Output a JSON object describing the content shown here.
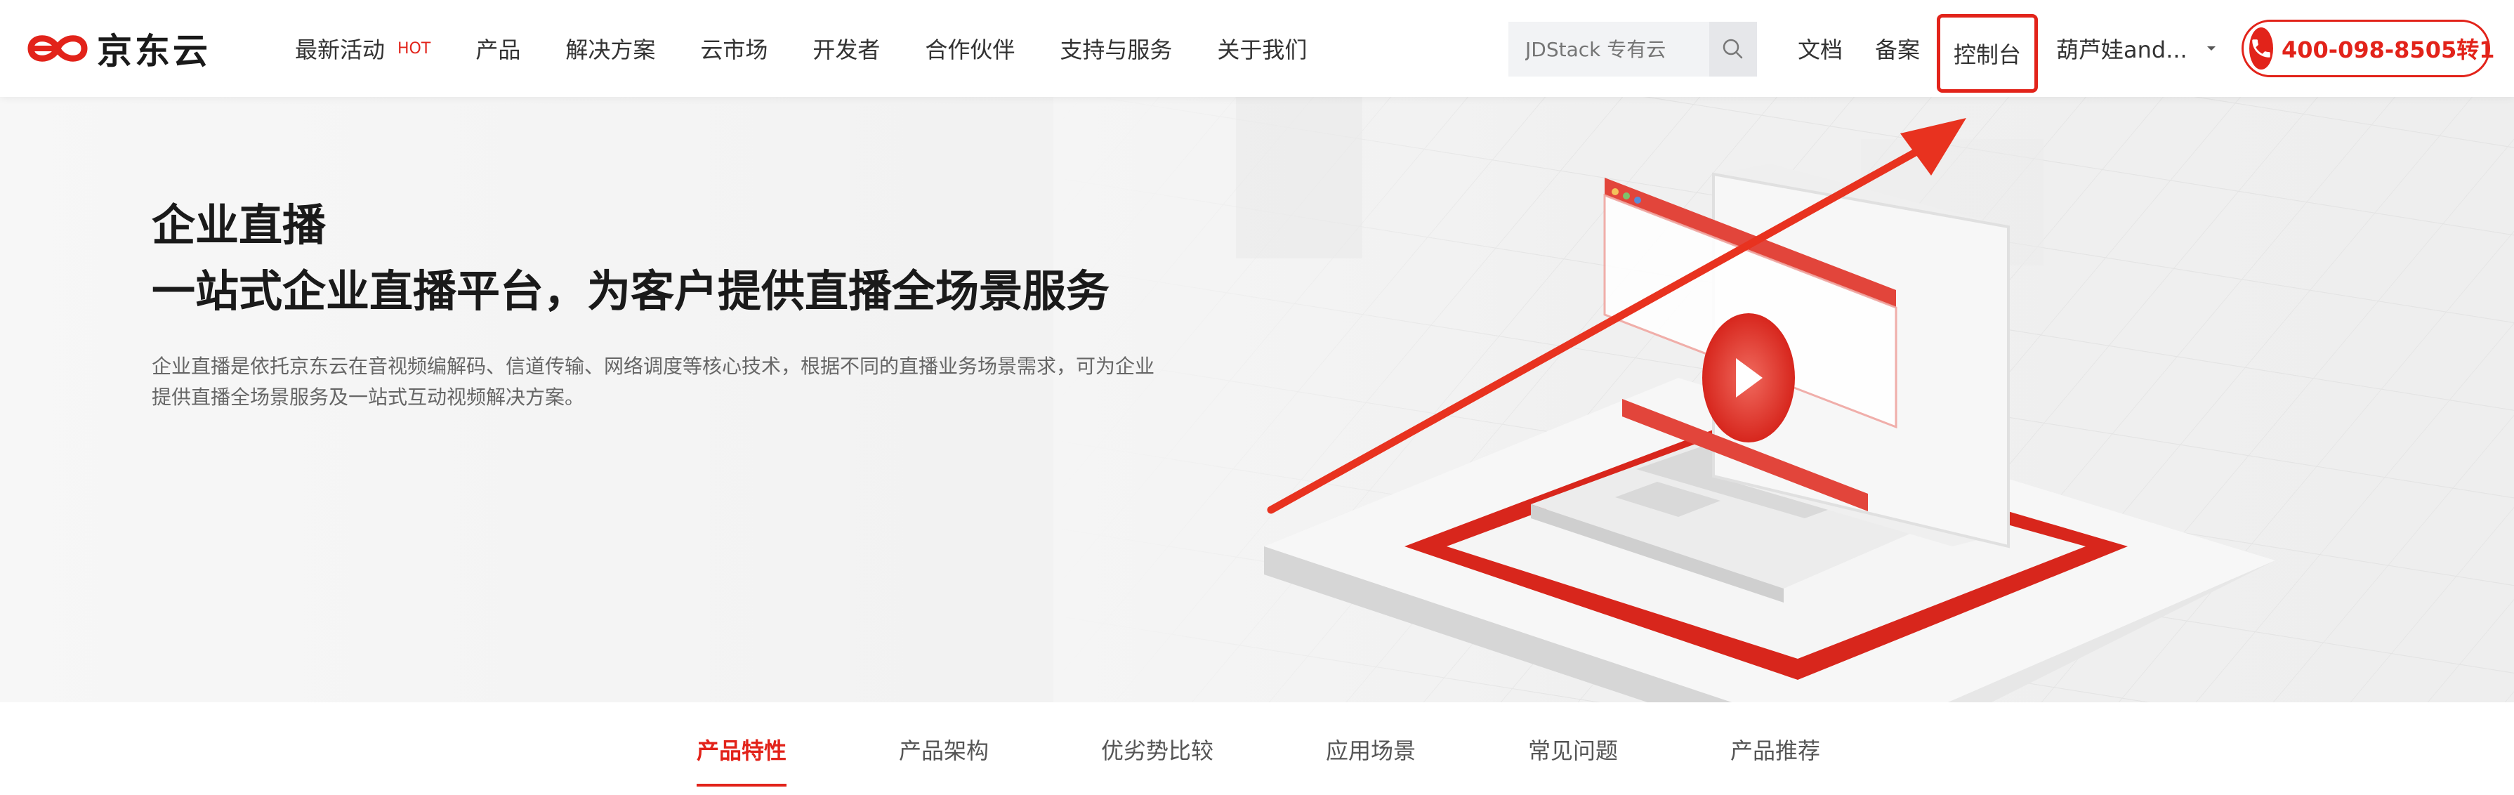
{
  "header": {
    "logo_text": "京东云",
    "nav": [
      {
        "label": "最新活动",
        "badge": "HOT"
      },
      {
        "label": "产品"
      },
      {
        "label": "解决方案"
      },
      {
        "label": "云市场"
      },
      {
        "label": "开发者"
      },
      {
        "label": "合作伙伴"
      },
      {
        "label": "支持与服务"
      },
      {
        "label": "关于我们"
      }
    ],
    "search": {
      "placeholder": "JDStack 专有云"
    },
    "docs_label": "文档",
    "beian_label": "备案",
    "console_label": "控制台",
    "user_name": "葫芦娃and...",
    "phone": "400-098-8505转1"
  },
  "hero": {
    "title": "企业直播",
    "subtitle": "一站式企业直播平台，为客户提供直播全场景服务",
    "description": "企业直播是依托京东云在音视频编解码、信道传输、网络调度等核心技术，根据不同的直播业务场景需求，可为企业提供直播全场景服务及一站式互动视频解决方案。"
  },
  "subnav": {
    "items": [
      "产品特性",
      "产品架构",
      "优劣势比较",
      "应用场景",
      "常见问题",
      "产品推荐"
    ],
    "active": "产品特性"
  },
  "colors": {
    "brand_red": "#e2231a",
    "text_dark": "#1a1a1a",
    "text_body": "#333333",
    "text_muted": "#666666"
  },
  "icons": [
    "jd-cloud-logo-icon",
    "search-icon",
    "caret-down-icon",
    "phone-icon",
    "annotation-arrow-icon"
  ]
}
